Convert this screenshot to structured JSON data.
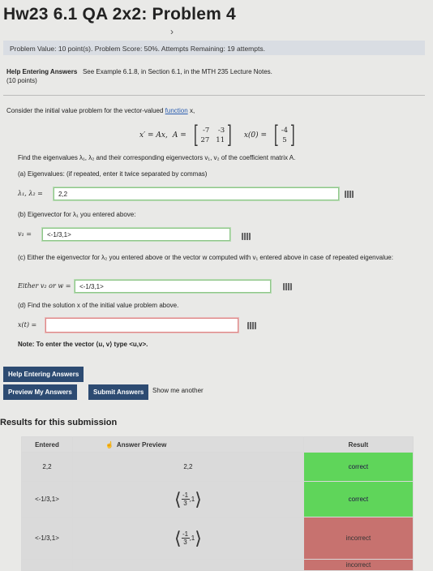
{
  "header": {
    "title": "Hw23 6.1 QA 2x2: Problem 4",
    "chevron": "›"
  },
  "infobar": {
    "text": "Problem Value: 10 point(s). Problem Score: 50%. Attempts Remaining: 19 attempts."
  },
  "help": {
    "label": "Help Entering Answers",
    "text": "See Example 6.1.8, in Section 6.1, in the MTH 235 Lecture Notes.",
    "points": "(10 points)"
  },
  "problem": {
    "consider_prefix": "Consider the initial value problem for the vector-valued",
    "consider_link": "function",
    "consider_suffix": "x,",
    "eq_lhs": "x′ = Ax,",
    "A_label": "A =",
    "A_matrix": [
      "-7",
      "-3",
      "27",
      "11"
    ],
    "x0_label": "x(0) =",
    "x0_vector": [
      "-4",
      "5"
    ],
    "find_text": "Find the eigenvalues λ₁, λ₂ and their corresponding eigenvectors v₁, v₂ of the coefficient matrix A.",
    "a_label": "(a) Eigenvalues: (if repeated, enter it twice separated by commas)",
    "a_prefix": "λ₁, λ₂ =",
    "a_value": "2,2",
    "b_label": "(b) Eigenvector for λ₁ you entered above:",
    "b_prefix": "v₁ =",
    "b_value": "<-1/3,1>",
    "c_label": "(c) Either the eigenvector for λ₂ you entered above or the vector w computed with v₁ entered above in case of repeated eigenvalue:",
    "c_prefix": "Either v₂ or w =",
    "c_value": "<-1/3,1>",
    "d_label": "(d) Find the solution x of the initial value problem above.",
    "d_prefix": "x(t) =",
    "d_value": "",
    "note": "Note: To enter the vector ⟨u, v⟩ type <u,v>."
  },
  "buttons": {
    "help_entering": "Help Entering Answers",
    "preview": "Preview My Answers",
    "submit": "Submit Answers",
    "show_another": "Show me another"
  },
  "results": {
    "title": "Results for this submission",
    "headers": [
      "Entered",
      "Answer Preview",
      "Result"
    ],
    "rows": [
      {
        "entered": "2,2",
        "preview": "2,2",
        "result": "correct"
      },
      {
        "entered": "<-1/3,1>",
        "preview_num": "-1",
        "preview_den": "3",
        "preview_tail": ",1",
        "result": "correct"
      },
      {
        "entered": "<-1/3,1>",
        "preview_num": "-1",
        "preview_den": "3",
        "preview_tail": ",1",
        "result": "incorrect"
      },
      {
        "entered": "",
        "preview": "",
        "result": "incorrect"
      }
    ]
  },
  "colors": {
    "correct": "#5fd55a",
    "incorrect": "#c7726f",
    "button": "#2d4b72"
  }
}
